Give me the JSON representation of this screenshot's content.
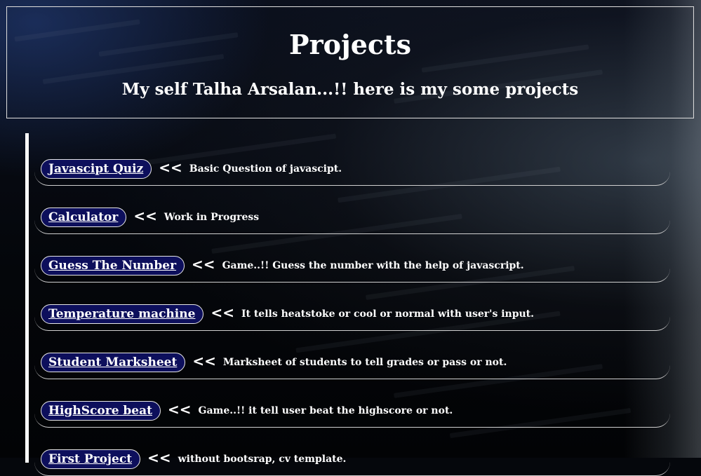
{
  "header": {
    "title": "Projects",
    "subtitle": "My self Talha Arsalan...!! here is my some projects"
  },
  "projects": [
    {
      "name": "Javascipt Quiz ",
      "arrow": "<<",
      "description": "Basic Question of javascipt."
    },
    {
      "name": "Calculator ",
      "arrow": "<<",
      "description": "Work in Progress"
    },
    {
      "name": "Guess The Number ",
      "arrow": "<<",
      "description": "Game..!! Guess the number with the help of javascript."
    },
    {
      "name": "Temperature machine ",
      "arrow": "<<",
      "description": "It tells heatstoke or cool or normal with user's input."
    },
    {
      "name": "Student Marksheet ",
      "arrow": "<<",
      "description": "Marksheet of students to tell grades or pass or not."
    },
    {
      "name": "HighScore beat ",
      "arrow": "<<",
      "description": "Game..!! it tell user beat the highscore or not."
    },
    {
      "name": "First Project ",
      "arrow": "<<",
      "description": "without bootsrap, cv template."
    }
  ],
  "colors": {
    "pill_background": "#0d0f5c",
    "text": "#ffffff",
    "page_background": "#05070c"
  }
}
